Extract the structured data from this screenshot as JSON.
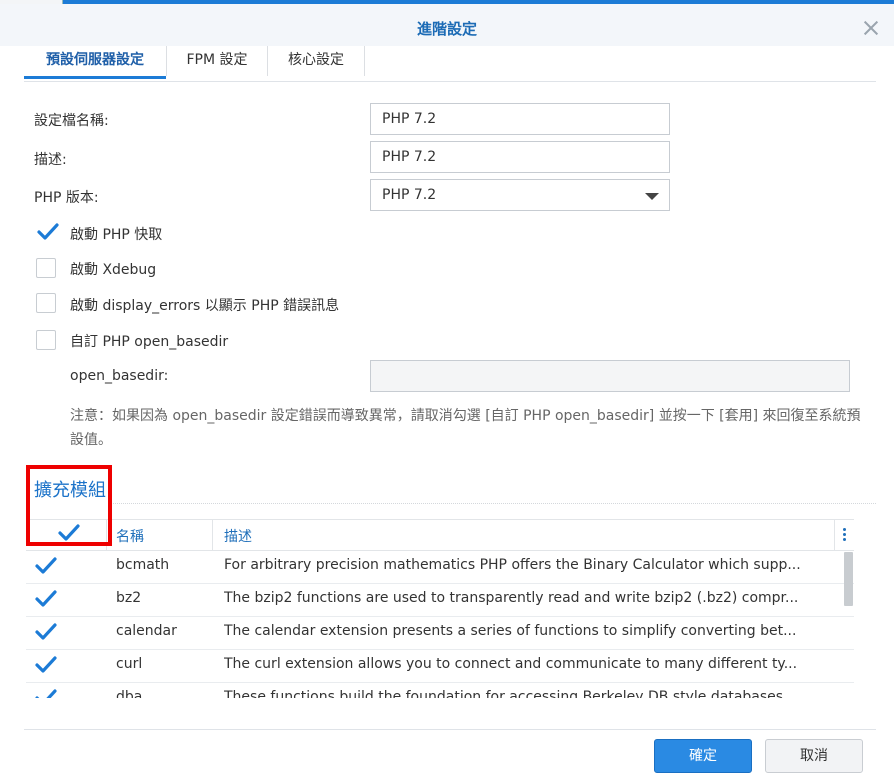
{
  "dialog": {
    "title": "進階設定"
  },
  "tabs": [
    {
      "label": "預設伺服器設定",
      "active": true
    },
    {
      "label": "FPM 設定",
      "active": false
    },
    {
      "label": "核心設定",
      "active": false
    }
  ],
  "form": {
    "profile_name_label": "設定檔名稱:",
    "profile_name_value": "PHP 7.2",
    "description_label": "描述:",
    "description_value": "PHP 7.2",
    "php_version_label": "PHP 版本:",
    "php_version_value": "PHP 7.2",
    "options": [
      {
        "label": "啟動 PHP 快取",
        "checked": true
      },
      {
        "label": "啟動 Xdebug",
        "checked": false
      },
      {
        "label": "啟動 display_errors 以顯示 PHP 錯誤訊息",
        "checked": false
      },
      {
        "label": "自訂 PHP open_basedir",
        "checked": false
      }
    ],
    "open_basedir_label": "open_basedir:",
    "open_basedir_value": "",
    "note": "注意：如果因為 open_basedir 設定錯誤而導致異常，請取消勾選 [自訂 PHP open_basedir] 並按一下 [套用] 來回復至系統預設值。"
  },
  "extensions": {
    "section_title": "擴充模組",
    "columns": {
      "name": "名稱",
      "description": "描述"
    },
    "select_all_checked": true,
    "rows": [
      {
        "name": "bcmath",
        "description": "For arbitrary precision mathematics PHP offers the Binary Calculator which supp...",
        "checked": true
      },
      {
        "name": "bz2",
        "description": "The bzip2 functions are used to transparently read and write bzip2 (.bz2) compr...",
        "checked": true
      },
      {
        "name": "calendar",
        "description": "The calendar extension presents a series of functions to simplify converting bet...",
        "checked": true
      },
      {
        "name": "curl",
        "description": "The curl extension allows you to connect and communicate to many different ty...",
        "checked": true
      },
      {
        "name": "dba",
        "description": "These functions build the foundation for accessing Berkeley DB style databases...",
        "checked": true
      }
    ]
  },
  "footer": {
    "ok_label": "確定",
    "cancel_label": "取消"
  },
  "colors": {
    "accent": "#1c7bd6",
    "highlight": "#ee0000",
    "primary_button": "#2a8ae3"
  }
}
